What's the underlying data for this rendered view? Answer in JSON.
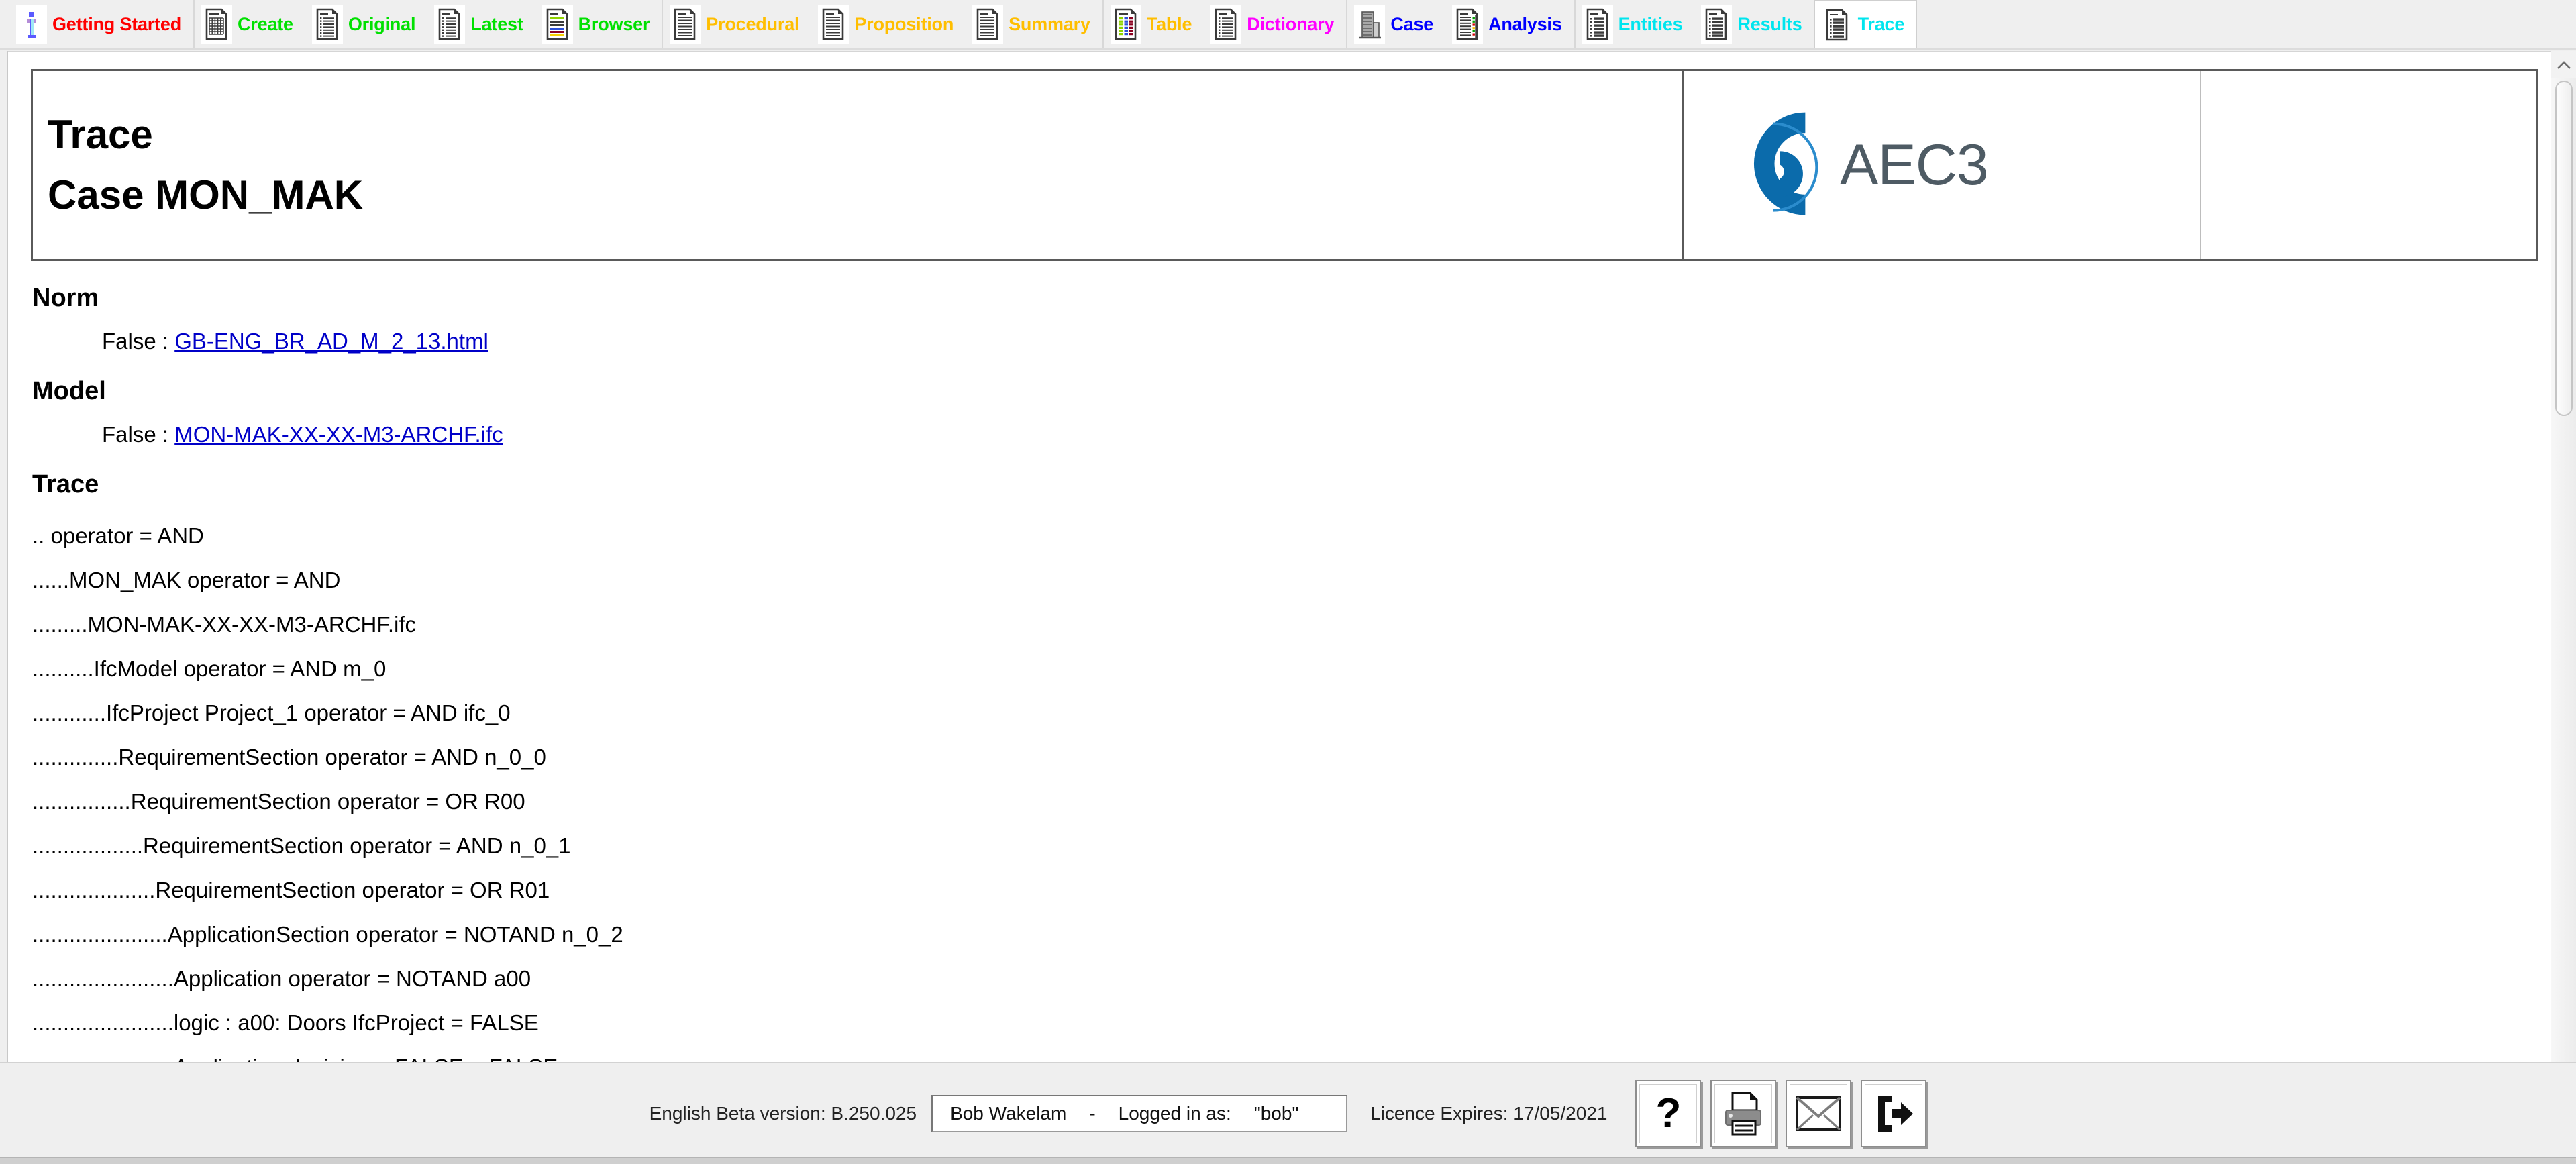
{
  "tabbar": {
    "groups": [
      {
        "tabs": [
          {
            "label": "Getting Started",
            "color": "#ff0000",
            "icon": "info-icon",
            "active": false
          }
        ]
      },
      {
        "tabs": [
          {
            "label": "Create",
            "color": "#00e000",
            "icon": "document-grid-icon",
            "active": false
          },
          {
            "label": "Original",
            "color": "#00e000",
            "icon": "document-lines-icon",
            "active": false
          },
          {
            "label": "Latest",
            "color": "#00e000",
            "icon": "document-lines-icon",
            "active": false
          },
          {
            "label": "Browser",
            "color": "#00e000",
            "icon": "document-color-lines-icon",
            "active": false
          }
        ]
      },
      {
        "tabs": [
          {
            "label": "Procedural",
            "color": "#ffbe00",
            "icon": "document-plain-icon",
            "active": false
          },
          {
            "label": "Proposition",
            "color": "#ffbe00",
            "icon": "document-plain-icon",
            "active": false
          },
          {
            "label": "Summary",
            "color": "#ffbe00",
            "icon": "document-plain-icon",
            "active": false
          }
        ]
      },
      {
        "tabs": [
          {
            "label": "Table",
            "color": "#ffbe00",
            "icon": "document-table-icon",
            "active": false
          },
          {
            "label": "Dictionary",
            "color": "#ff00ff",
            "icon": "document-lines-icon",
            "active": false
          }
        ]
      },
      {
        "tabs": [
          {
            "label": "Case",
            "color": "#0000ff",
            "icon": "building-icon",
            "active": false
          },
          {
            "label": "Analysis",
            "color": "#0000ff",
            "icon": "document-analysis-icon",
            "active": false
          }
        ]
      },
      {
        "tabs": [
          {
            "label": "Entities",
            "color": "#00e5ee",
            "icon": "document-list-icon",
            "active": false
          },
          {
            "label": "Results",
            "color": "#00e5ee",
            "icon": "document-list-icon",
            "active": false
          },
          {
            "label": "Trace",
            "color": "#00e5ee",
            "icon": "document-list-icon",
            "active": true
          }
        ]
      }
    ]
  },
  "header": {
    "title": "Trace",
    "subtitle": "Case MON_MAK",
    "logo_text": "AEC3",
    "logo_color": "#0b6bab",
    "logo_text_color": "#4e5b64"
  },
  "sections": [
    {
      "heading": "Norm",
      "prefix": "False : ",
      "link": "GB-ENG_BR_AD_M_2_13.html"
    },
    {
      "heading": "Model",
      "prefix": "False : ",
      "link": "MON-MAK-XX-XX-M3-ARCHF.ifc"
    }
  ],
  "trace": {
    "heading": "Trace",
    "lines": [
      ".. operator = AND",
      "......MON_MAK operator = AND",
      ".........MON-MAK-XX-XX-M3-ARCHF.ifc",
      "..........IfcModel operator = AND m_0",
      "............IfcProject Project_1 operator = AND ifc_0",
      "..............RequirementSection operator = AND n_0_0",
      "................RequirementSection operator = OR R00",
      "..................RequirementSection operator = AND n_0_1",
      "....................RequirementSection operator = OR R01",
      "......................ApplicationSection operator = NOTAND n_0_2",
      ".......................Application operator = NOTAND a00",
      ".......................logic : a00: Doors IfcProject = FALSE",
      ".......................Application decision = FALSE = FALSE"
    ]
  },
  "footer": {
    "version": "English Beta version: B.250.025",
    "user_name": "Bob Wakelam",
    "separator": "-",
    "logged_in_label": "Logged in as:",
    "logged_in_value": "\"bob\"",
    "licence": "Licence Expires: 17/05/2021",
    "buttons": [
      {
        "name": "help-button",
        "icon": "question-mark-icon"
      },
      {
        "name": "print-button",
        "icon": "printer-icon"
      },
      {
        "name": "mail-button",
        "icon": "envelope-icon"
      },
      {
        "name": "logout-button",
        "icon": "exit-arrow-icon"
      }
    ]
  },
  "scrollbar": {
    "position": "right",
    "arrow": "chevron-up-icon"
  }
}
